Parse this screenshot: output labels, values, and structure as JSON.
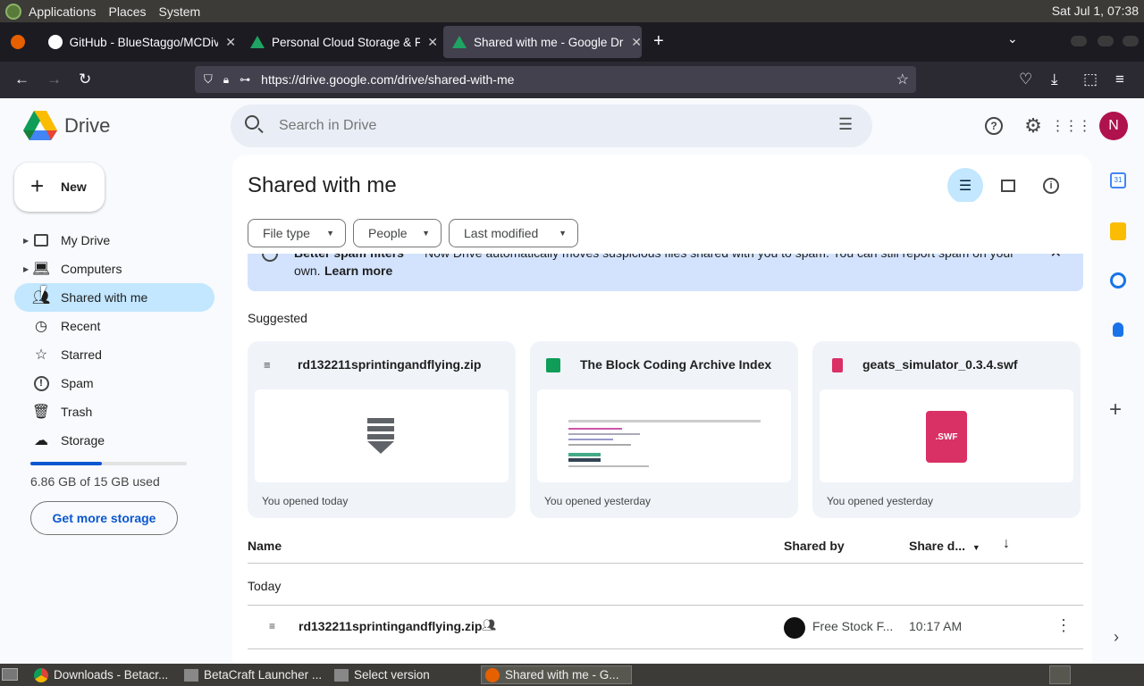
{
  "system_panel": {
    "menus": [
      "Applications",
      "Places",
      "System"
    ],
    "clock": "Sat Jul 1, 07:38"
  },
  "browser": {
    "tabs": [
      {
        "title": "GitHub - BlueStaggo/MCDiv",
        "icon": "github-icon"
      },
      {
        "title": "Personal Cloud Storage & Fi",
        "icon": "google-drive-icon"
      },
      {
        "title": "Shared with me - Google Dr",
        "icon": "google-drive-icon"
      }
    ],
    "url": "https://drive.google.com/drive/shared-with-me"
  },
  "drive": {
    "logo_text": "Drive",
    "search_placeholder": "Search in Drive",
    "avatar_initial": "N",
    "avatar_color": "#b0124e",
    "new_button": "New",
    "sidebar": [
      {
        "label": "My Drive",
        "icon": "my-drive-icon",
        "expandable": true
      },
      {
        "label": "Computers",
        "icon": "computers-icon",
        "expandable": true
      },
      {
        "label": "Shared with me",
        "icon": "shared-icon",
        "active": true
      },
      {
        "label": "Recent",
        "icon": "clock-icon"
      },
      {
        "label": "Starred",
        "icon": "star-icon"
      },
      {
        "label": "Spam",
        "icon": "spam-icon"
      },
      {
        "label": "Trash",
        "icon": "trash-icon"
      },
      {
        "label": "Storage",
        "icon": "cloud-icon"
      }
    ],
    "storage": {
      "used_text": "6.86 GB of 15 GB used",
      "used_fraction": 0.457,
      "get_more": "Get more storage"
    },
    "page_title": "Shared with me",
    "filters": [
      "File type",
      "People",
      "Last modified"
    ],
    "banner": {
      "title": "Better spam filters",
      "text": "Now Drive automatically moves suspicious files shared with you to spam. You can still report spam on your",
      "text2": "own.",
      "link": "Learn more"
    },
    "suggested_label": "Suggested",
    "suggested": [
      {
        "name": "rd132211sprintingandflying.zip",
        "meta": "You opened today",
        "icon": "zip-icon"
      },
      {
        "name": "The Block Coding Archive Index",
        "meta": "You opened yesterday",
        "icon": "sheets-icon"
      },
      {
        "name": "geats_simulator_0.3.4.swf",
        "meta": "You opened yesterday",
        "icon": "file-icon",
        "thumb_label": ".SWF"
      }
    ],
    "table": {
      "col_name": "Name",
      "col_shared_by": "Shared by",
      "col_share_date": "Share d...",
      "group": "Today",
      "rows": [
        {
          "name": "rd132211sprintingandflying.zip",
          "shared_by": "Free Stock F...",
          "date": "10:17 AM"
        }
      ]
    }
  },
  "taskbar": {
    "tasks": [
      {
        "title": "Downloads - Betacr...",
        "icon": "chrome-icon"
      },
      {
        "title": "BetaCraft Launcher ...",
        "icon": "java-icon"
      },
      {
        "title": "Select version",
        "icon": "java-icon"
      },
      {
        "title": "Shared with me - G...",
        "icon": "firefox-icon",
        "active": true
      }
    ]
  }
}
